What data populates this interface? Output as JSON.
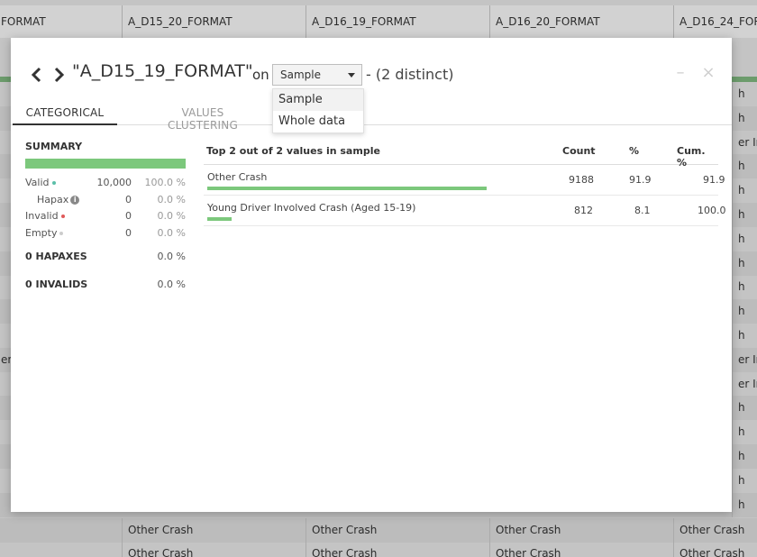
{
  "background": {
    "column_headers": [
      "FORMAT",
      "A_D15_20_FORMAT",
      "A_D16_19_FORMAT",
      "A_D16_20_FORMAT",
      "A_D16_24_FORMAT"
    ],
    "row_fragments_right": [
      "h",
      "h",
      "er Inv",
      "h",
      "h",
      "h",
      "h",
      "h",
      "h",
      "h",
      "h",
      "er Inv",
      "er Inv",
      "h",
      "h",
      "h",
      "h",
      "h"
    ],
    "row_fragments_left": [
      "er I"
    ],
    "bottom_rows": [
      [
        "",
        "Other Crash",
        "Other Crash",
        "Other Crash",
        "Other Crash"
      ],
      [
        "",
        "Other Crash",
        "Other Crash",
        "Other Crash",
        "Other Crash"
      ]
    ]
  },
  "modal": {
    "column_title": "\"A_D15_19_FORMAT\"",
    "on_word": "on",
    "sample_select": {
      "selected": "Sample",
      "options": [
        "Sample",
        "Whole data"
      ]
    },
    "distinct_text": "- (2 distinct)",
    "minimize_glyph": "–",
    "close_glyph": "×",
    "tabs": [
      {
        "label": "CATEGORICAL",
        "active": true
      },
      {
        "label": "VALUES CLUSTERING",
        "active": false
      }
    ],
    "summary": {
      "heading": "SUMMARY",
      "rows": [
        {
          "label": "Valid",
          "count": "10,000",
          "pct": "100.0 %"
        },
        {
          "label": "Hapax",
          "count": "0",
          "pct": "0.0 %"
        },
        {
          "label": "Invalid",
          "count": "0",
          "pct": "0.0 %"
        },
        {
          "label": "Empty",
          "count": "0",
          "pct": "0.0 %"
        }
      ],
      "hapaxes": {
        "label": "0 HAPAXES",
        "pct": "0.0 %"
      },
      "invalids": {
        "label": "0 INVALIDS",
        "pct": "0.0 %"
      },
      "valid_fraction": 1.0
    },
    "values_table": {
      "title": "Top 2 out of 2 values in sample",
      "col_count": "Count",
      "col_pct": "%",
      "col_cum": "Cum. %",
      "rows": [
        {
          "name": "Other Crash",
          "count": "9188",
          "pct": "91.9",
          "cum": "91.9",
          "fraction": 0.919
        },
        {
          "name": "Young Driver Involved Crash (Aged 15-19)",
          "count": "812",
          "pct": "8.1",
          "cum": "100.0",
          "fraction": 0.081
        }
      ]
    },
    "colors": {
      "bar_green": "#7cc87c",
      "valid_dot": "#5bbfa8",
      "invalid_dot": "#e05a5a",
      "empty_dot": "#cccccc"
    }
  }
}
